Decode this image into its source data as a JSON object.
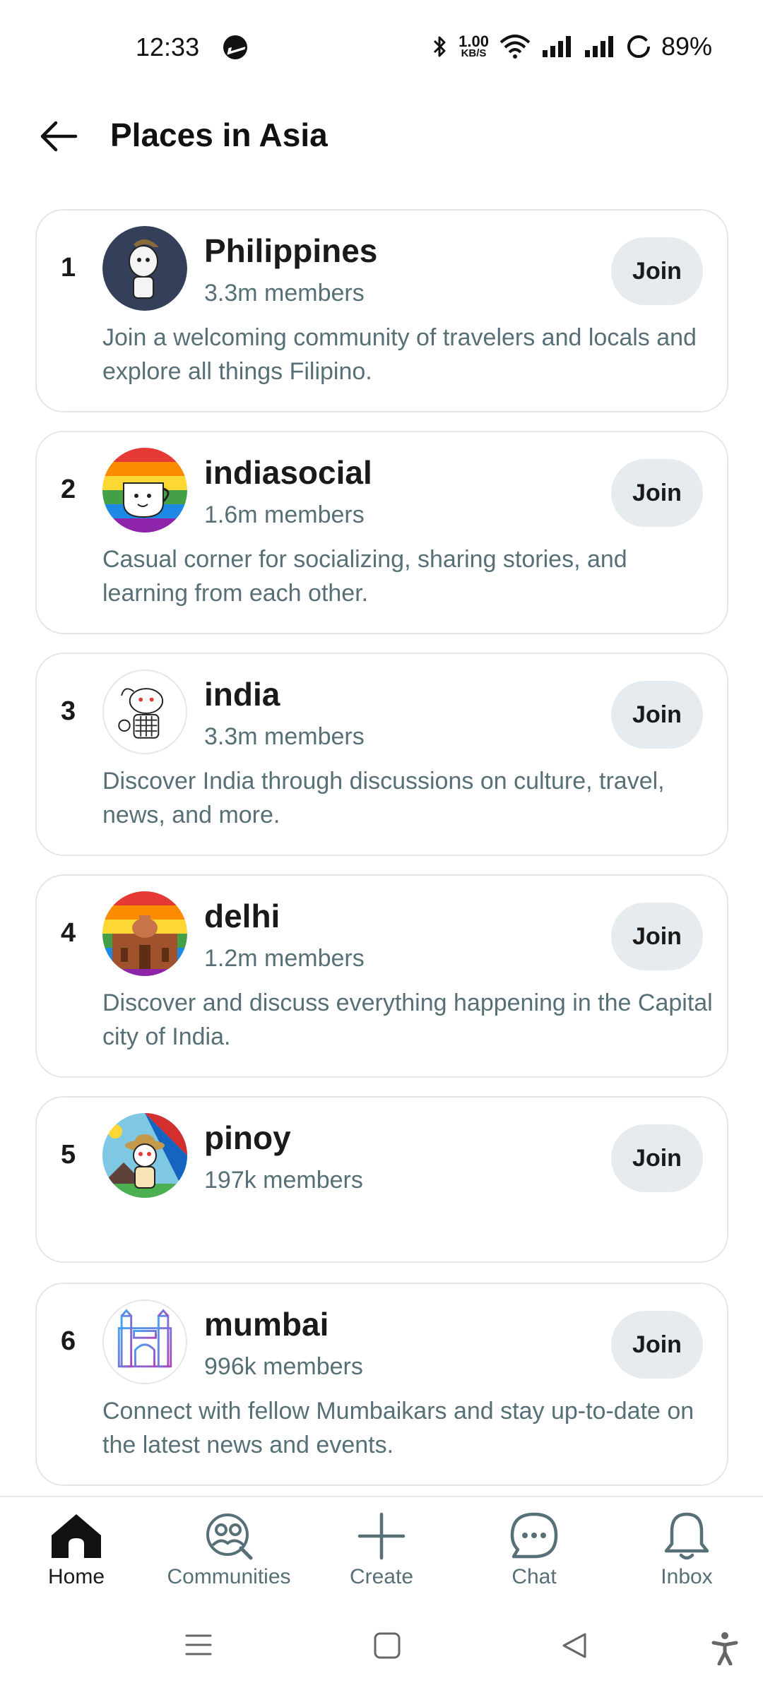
{
  "status_bar": {
    "time": "12:33",
    "net_speed_value": "1.00",
    "net_speed_unit": "KB/S",
    "battery": "89%"
  },
  "header": {
    "title": "Places in Asia"
  },
  "communities": [
    {
      "rank": "1",
      "name": "Philippines",
      "members": "3.3m members",
      "description": "Join a welcoming community of travelers and locals and explore all things Filipino.",
      "join_label": "Join"
    },
    {
      "rank": "2",
      "name": "indiasocial",
      "members": "1.6m members",
      "description": "Casual corner for socializing, sharing stories, and learning from each other.",
      "join_label": "Join"
    },
    {
      "rank": "3",
      "name": "india",
      "members": "3.3m members",
      "description": "Discover India through discussions on culture, travel, news, and more.",
      "join_label": "Join"
    },
    {
      "rank": "4",
      "name": "delhi",
      "members": "1.2m members",
      "description": "Discover and discuss everything happening in the Capital city of India.",
      "join_label": "Join"
    },
    {
      "rank": "5",
      "name": "pinoy",
      "members": "197k members",
      "description": "",
      "join_label": "Join"
    },
    {
      "rank": "6",
      "name": "mumbai",
      "members": "996k members",
      "description": "Connect with fellow Mumbaikars and stay up-to-date on the latest news and events.",
      "join_label": "Join"
    }
  ],
  "bottom_nav": {
    "items": [
      {
        "label": "Home",
        "icon": "home-icon",
        "active": true
      },
      {
        "label": "Communities",
        "icon": "communities-icon",
        "active": false
      },
      {
        "label": "Create",
        "icon": "plus-icon",
        "active": false
      },
      {
        "label": "Chat",
        "icon": "chat-icon",
        "active": false
      },
      {
        "label": "Inbox",
        "icon": "bell-icon",
        "active": false
      }
    ]
  },
  "colors": {
    "text_primary": "#1a1a1b",
    "text_secondary": "#576f76",
    "join_button_bg": "#e5ebee",
    "card_border": "#e4e6e9"
  }
}
